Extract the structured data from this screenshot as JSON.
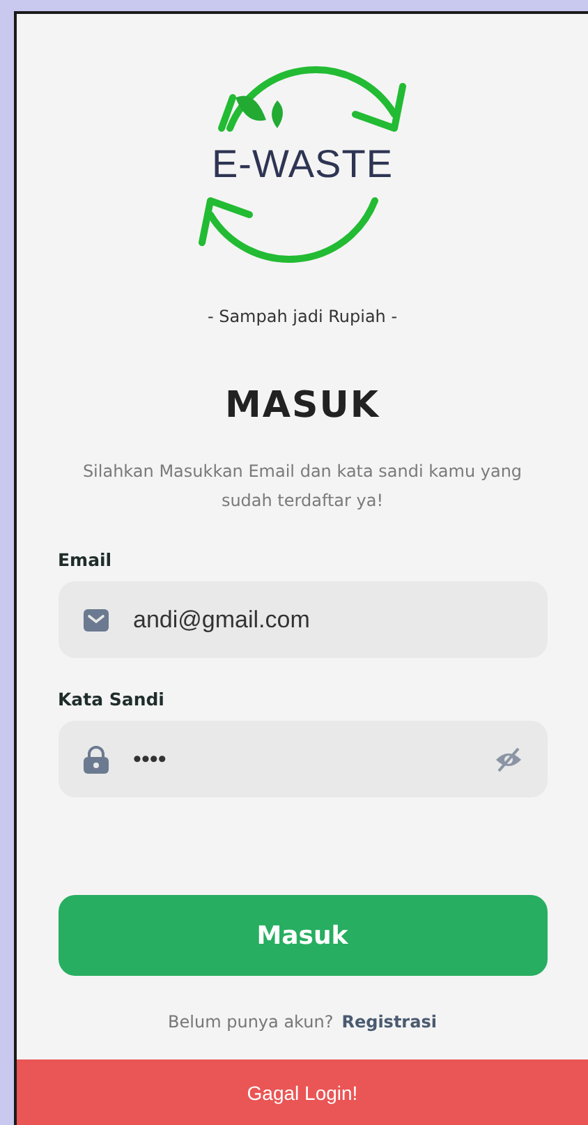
{
  "logo": {
    "text": "E-WASTE"
  },
  "tagline": "- Sampah jadi Rupiah -",
  "title": "MASUK",
  "description": "Silahkan Masukkan Email dan kata sandi kamu yang sudah terdaftar ya!",
  "fields": [
    {
      "kind": "email",
      "label": "Email",
      "value": "andi@gmail.com"
    },
    {
      "kind": "password",
      "label": "Kata Sandi",
      "value": "••••"
    }
  ],
  "submit_button": "Masuk",
  "register_prompt": {
    "text": "Belum punya akun?",
    "link": "Registrasi"
  },
  "toast": "Gagal Login!"
}
